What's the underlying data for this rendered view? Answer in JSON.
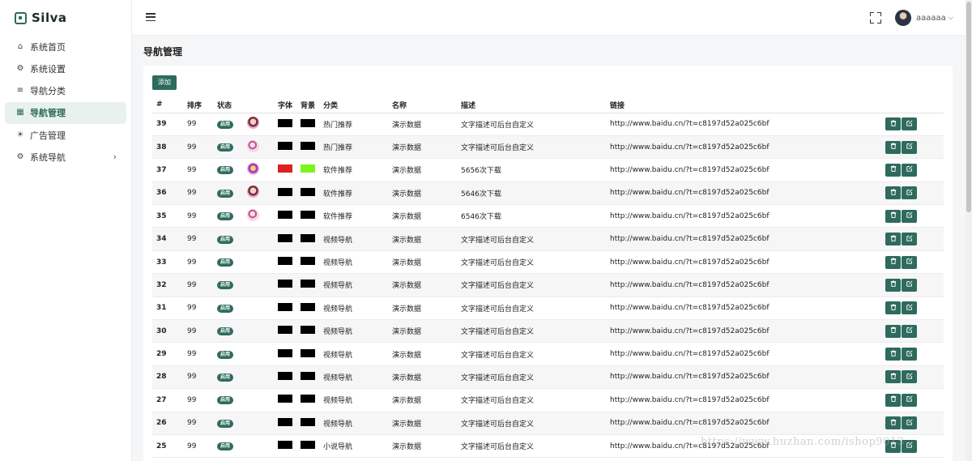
{
  "brand": {
    "name": "Silva",
    "color": "#2e6b5e"
  },
  "sidebar": {
    "items": [
      {
        "label": "系统首页",
        "icon": "home-icon",
        "active": false
      },
      {
        "label": "系统设置",
        "icon": "gear-icon",
        "active": false
      },
      {
        "label": "导航分类",
        "icon": "list-icon",
        "active": false
      },
      {
        "label": "导航管理",
        "icon": "grid-icon",
        "active": true
      },
      {
        "label": "广告管理",
        "icon": "sun-icon",
        "active": false
      },
      {
        "label": "系统导航",
        "icon": "gear-icon",
        "active": false,
        "has_children": true
      }
    ]
  },
  "header": {
    "username": "aaaaaa"
  },
  "page": {
    "title": "导航管理",
    "add_label": "添加"
  },
  "table": {
    "columns": [
      "#",
      "排序",
      "状态",
      "",
      "字体",
      "背景",
      "分类",
      "名称",
      "描述",
      "链接",
      ""
    ],
    "rows": [
      {
        "id": "39",
        "sort": "99",
        "status": "启用",
        "thumb": "portrait-a",
        "font_color": "#000000",
        "bg_color": "#000000",
        "category": "热门推荐",
        "name": "演示数据",
        "desc": "文字描述可后台自定义",
        "link": "http://www.baidu.cn/?t=c8197d52a025c6bf"
      },
      {
        "id": "38",
        "sort": "99",
        "status": "启用",
        "thumb": "portrait-b",
        "font_color": "#000000",
        "bg_color": "#000000",
        "category": "热门推荐",
        "name": "演示数据",
        "desc": "文字描述可后台自定义",
        "link": "http://www.baidu.cn/?t=c8197d52a025c6bf"
      },
      {
        "id": "37",
        "sort": "99",
        "status": "启用",
        "thumb": "portrait-c",
        "font_color": "#e02020",
        "bg_color": "#7cf51c",
        "category": "软件推荐",
        "name": "演示数据",
        "desc": "5656次下载",
        "link": "http://www.baidu.cn/?t=c8197d52a025c6bf"
      },
      {
        "id": "36",
        "sort": "99",
        "status": "启用",
        "thumb": "portrait-a",
        "font_color": "#000000",
        "bg_color": "#000000",
        "category": "软件推荐",
        "name": "演示数据",
        "desc": "5646次下载",
        "link": "http://www.baidu.cn/?t=c8197d52a025c6bf"
      },
      {
        "id": "35",
        "sort": "99",
        "status": "启用",
        "thumb": "portrait-b",
        "font_color": "#000000",
        "bg_color": "#000000",
        "category": "软件推荐",
        "name": "演示数据",
        "desc": "6546次下载",
        "link": "http://www.baidu.cn/?t=c8197d52a025c6bf"
      },
      {
        "id": "34",
        "sort": "99",
        "status": "启用",
        "thumb": "",
        "font_color": "#000000",
        "bg_color": "#000000",
        "category": "视频导航",
        "name": "演示数据",
        "desc": "文字描述可后台自定义",
        "link": "http://www.baidu.cn/?t=c8197d52a025c6bf"
      },
      {
        "id": "33",
        "sort": "99",
        "status": "启用",
        "thumb": "",
        "font_color": "#000000",
        "bg_color": "#000000",
        "category": "视频导航",
        "name": "演示数据",
        "desc": "文字描述可后台自定义",
        "link": "http://www.baidu.cn/?t=c8197d52a025c6bf"
      },
      {
        "id": "32",
        "sort": "99",
        "status": "启用",
        "thumb": "",
        "font_color": "#000000",
        "bg_color": "#000000",
        "category": "视频导航",
        "name": "演示数据",
        "desc": "文字描述可后台自定义",
        "link": "http://www.baidu.cn/?t=c8197d52a025c6bf"
      },
      {
        "id": "31",
        "sort": "99",
        "status": "启用",
        "thumb": "",
        "font_color": "#000000",
        "bg_color": "#000000",
        "category": "视频导航",
        "name": "演示数据",
        "desc": "文字描述可后台自定义",
        "link": "http://www.baidu.cn/?t=c8197d52a025c6bf"
      },
      {
        "id": "30",
        "sort": "99",
        "status": "启用",
        "thumb": "",
        "font_color": "#000000",
        "bg_color": "#000000",
        "category": "视频导航",
        "name": "演示数据",
        "desc": "文字描述可后台自定义",
        "link": "http://www.baidu.cn/?t=c8197d52a025c6bf"
      },
      {
        "id": "29",
        "sort": "99",
        "status": "启用",
        "thumb": "",
        "font_color": "#000000",
        "bg_color": "#000000",
        "category": "视频导航",
        "name": "演示数据",
        "desc": "文字描述可后台自定义",
        "link": "http://www.baidu.cn/?t=c8197d52a025c6bf"
      },
      {
        "id": "28",
        "sort": "99",
        "status": "启用",
        "thumb": "",
        "font_color": "#000000",
        "bg_color": "#000000",
        "category": "视频导航",
        "name": "演示数据",
        "desc": "文字描述可后台自定义",
        "link": "http://www.baidu.cn/?t=c8197d52a025c6bf"
      },
      {
        "id": "27",
        "sort": "99",
        "status": "启用",
        "thumb": "",
        "font_color": "#000000",
        "bg_color": "#000000",
        "category": "视频导航",
        "name": "演示数据",
        "desc": "文字描述可后台自定义",
        "link": "http://www.baidu.cn/?t=c8197d52a025c6bf"
      },
      {
        "id": "26",
        "sort": "99",
        "status": "启用",
        "thumb": "",
        "font_color": "#000000",
        "bg_color": "#000000",
        "category": "视频导航",
        "name": "演示数据",
        "desc": "文字描述可后台自定义",
        "link": "http://www.baidu.cn/?t=c8197d52a025c6bf"
      },
      {
        "id": "25",
        "sort": "99",
        "status": "启用",
        "thumb": "",
        "font_color": "#000000",
        "bg_color": "#000000",
        "category": "小说导航",
        "name": "演示数据",
        "desc": "文字描述可后台自定义",
        "link": "http://www.baidu.cn/?t=c8197d52a025c6bf"
      }
    ]
  },
  "watermark": "https://www.huzhan.com/ishop9013"
}
